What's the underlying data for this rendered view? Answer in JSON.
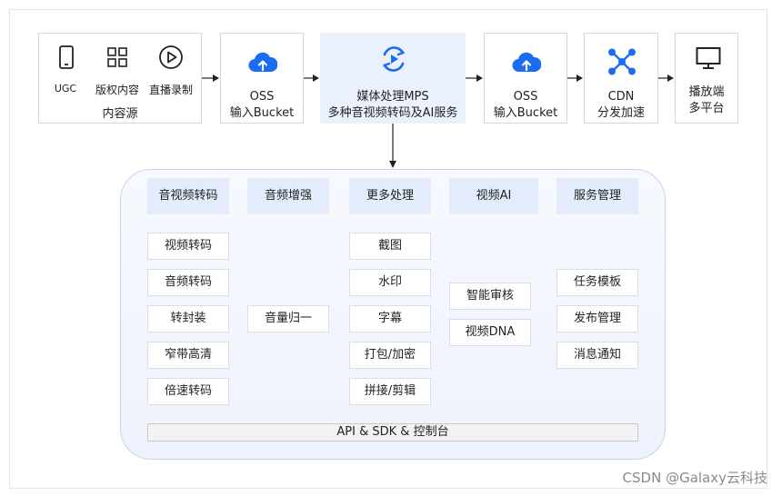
{
  "colors": {
    "accent": "#1a6cf2",
    "highlight_bg": "#eaf1fd",
    "header_bg": "#e4ecfc"
  },
  "source": {
    "items": [
      {
        "label": "UGC",
        "icon": "phone-icon"
      },
      {
        "label": "版权内容",
        "icon": "grid-icon"
      },
      {
        "label": "直播录制",
        "icon": "play-icon"
      }
    ],
    "title": "内容源"
  },
  "oss_in": {
    "line1": "OSS",
    "line2": "输入Bucket",
    "icon": "cloud-upload-icon"
  },
  "mps": {
    "line1": "媒体处理MPS",
    "line2": "多种音视频转码及AI服务",
    "icon": "media-process-icon"
  },
  "oss_out": {
    "line1": "OSS",
    "line2": "输入Bucket",
    "icon": "cloud-upload-icon"
  },
  "cdn": {
    "line1": "CDN",
    "line2": "分发加速",
    "icon": "network-icon"
  },
  "player": {
    "line1": "播放端",
    "line2": "多平台",
    "icon": "monitor-icon"
  },
  "columns": [
    {
      "header": "音视频转码",
      "items": [
        "视频转码",
        "音频转码",
        "转封装",
        "窄带高清",
        "倍速转码"
      ]
    },
    {
      "header": "音频增强",
      "items": [
        "音量归一"
      ]
    },
    {
      "header": "更多处理",
      "items": [
        "截图",
        "水印",
        "字幕",
        "打包/加密",
        "拼接/剪辑"
      ]
    },
    {
      "header": "视频AI",
      "items": [
        "智能审核",
        "视频DNA"
      ]
    },
    {
      "header": "服务管理",
      "items": [
        "任务模板",
        "发布管理",
        "消息通知"
      ]
    }
  ],
  "api_bar": "API & SDK & 控制台",
  "watermark": "CSDN @Galaxy云科技"
}
